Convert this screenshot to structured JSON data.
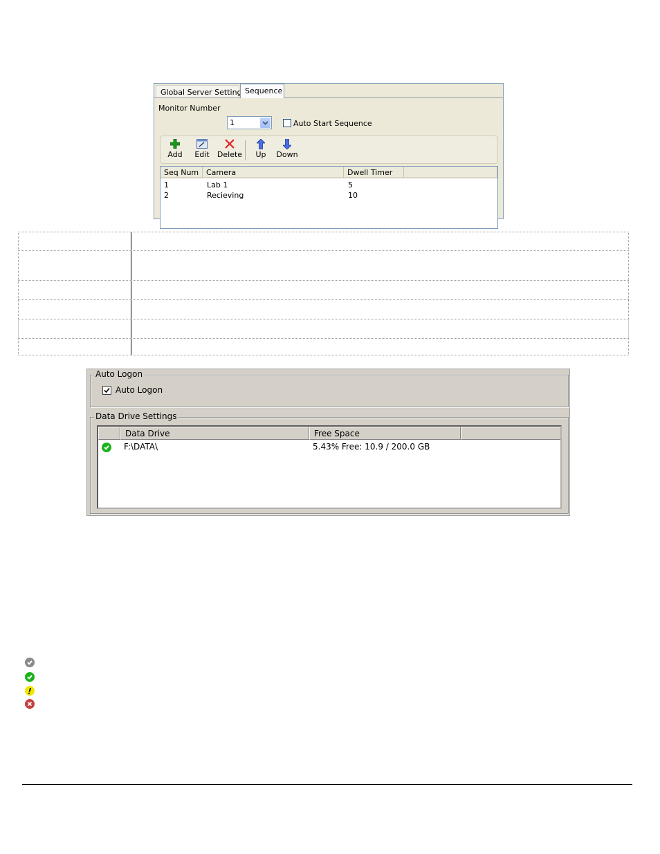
{
  "sequence_dialog": {
    "tabs": [
      "Global Server Settings",
      "Sequence"
    ],
    "active_tab": "Sequence",
    "monitor_number_label": "Monitor Number",
    "monitor_number_value": "1",
    "auto_start_label": "Auto Start Sequence",
    "auto_start_checked": false,
    "toolbar": {
      "add": "Add",
      "edit": "Edit",
      "delete": "Delete",
      "up": "Up",
      "down": "Down"
    },
    "columns": [
      "Seq Num",
      "Camera",
      "Dwell Timer"
    ],
    "rows": [
      {
        "seq": "1",
        "camera": "Lab 1",
        "dwell": "5"
      },
      {
        "seq": "2",
        "camera": "Recieving",
        "dwell": "10"
      }
    ]
  },
  "drive_panel": {
    "auto_logon_group": "Auto Logon",
    "auto_logon_checkbox": "Auto Logon",
    "auto_logon_checked": true,
    "data_drive_group": "Data Drive Settings",
    "columns": [
      "Data Drive",
      "Free Space"
    ],
    "rows": [
      {
        "status": "ok",
        "drive": "F:\\DATA\\",
        "free_space": "5.43% Free: 10.9 / 200.0 GB"
      }
    ]
  },
  "status_icons": [
    {
      "name": "gray-check-icon",
      "color": "#8a8a8a"
    },
    {
      "name": "green-check-icon",
      "color": "#1bb31b"
    },
    {
      "name": "yellow-warning-icon",
      "color": "#f2e600"
    },
    {
      "name": "red-error-icon",
      "color": "#c84040"
    }
  ],
  "colors": {
    "dialog_bg": "#ece9d8",
    "panel_bg": "#d4d0c8",
    "ok_green": "#1bb31b"
  }
}
